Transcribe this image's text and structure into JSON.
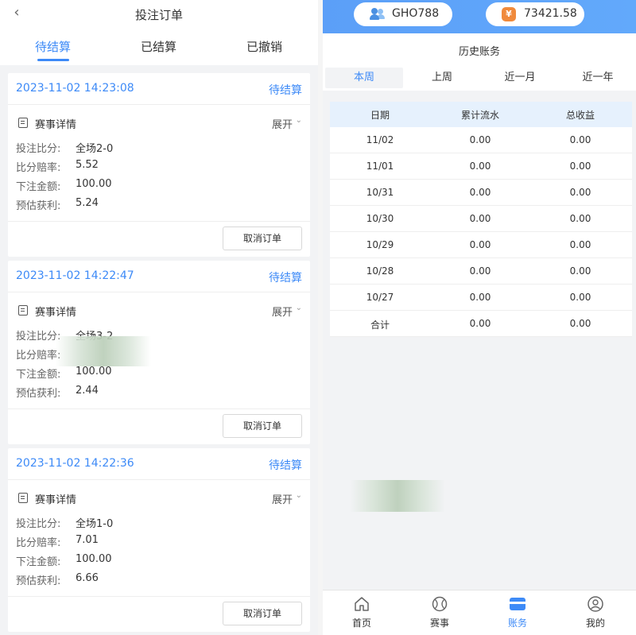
{
  "left": {
    "title": "投注订单",
    "back_icon": "chevron-left-icon",
    "tabs": [
      {
        "label": "待结算",
        "active": true
      },
      {
        "label": "已结算",
        "active": false
      },
      {
        "label": "已撤销",
        "active": false
      }
    ],
    "orders": [
      {
        "time": "2023-11-02 14:23:08",
        "status": "待结算",
        "detail_label": "赛事详情",
        "expand_label": "展开",
        "fields": [
          {
            "k": "投注比分:",
            "v": "全场2-0"
          },
          {
            "k": "比分赔率:",
            "v": "5.52"
          },
          {
            "k": "下注金额:",
            "v": "100.00"
          },
          {
            "k": "预估获利:",
            "v": "5.24"
          }
        ],
        "cancel_label": "取消订单"
      },
      {
        "time": "2023-11-02 14:22:47",
        "status": "待结算",
        "detail_label": "赛事详情",
        "expand_label": "展开",
        "fields": [
          {
            "k": "投注比分:",
            "v": "全场3-2"
          },
          {
            "k": "比分赔率:",
            "v": ""
          },
          {
            "k": "下注金额:",
            "v": "100.00"
          },
          {
            "k": "预估获利:",
            "v": "2.44"
          }
        ],
        "cancel_label": "取消订单"
      },
      {
        "time": "2023-11-02 14:22:36",
        "status": "待结算",
        "detail_label": "赛事详情",
        "expand_label": "展开",
        "fields": [
          {
            "k": "投注比分:",
            "v": "全场1-0"
          },
          {
            "k": "比分赔率:",
            "v": "7.01"
          },
          {
            "k": "下注金额:",
            "v": "100.00"
          },
          {
            "k": "预估获利:",
            "v": "6.66"
          }
        ],
        "cancel_label": "取消订单"
      }
    ]
  },
  "right": {
    "username": "GHO788",
    "balance": "73421.58",
    "accent": "#3d8af7",
    "title": "历史账务",
    "periods": [
      {
        "label": "本周",
        "active": true
      },
      {
        "label": "上周",
        "active": false
      },
      {
        "label": "近一月",
        "active": false
      },
      {
        "label": "近一年",
        "active": false
      }
    ],
    "table": {
      "headers": [
        "日期",
        "累计流水",
        "总收益"
      ],
      "rows": [
        [
          "11/02",
          "0.00",
          "0.00"
        ],
        [
          "11/01",
          "0.00",
          "0.00"
        ],
        [
          "10/31",
          "0.00",
          "0.00"
        ],
        [
          "10/30",
          "0.00",
          "0.00"
        ],
        [
          "10/29",
          "0.00",
          "0.00"
        ],
        [
          "10/28",
          "0.00",
          "0.00"
        ],
        [
          "10/27",
          "0.00",
          "0.00"
        ],
        [
          "合计",
          "0.00",
          "0.00"
        ]
      ]
    },
    "nav": [
      {
        "label": "首页",
        "icon": "home-icon",
        "active": false
      },
      {
        "label": "赛事",
        "icon": "ball-icon",
        "active": false
      },
      {
        "label": "账务",
        "icon": "card-icon",
        "active": true
      },
      {
        "label": "我的",
        "icon": "user-icon",
        "active": false
      }
    ]
  }
}
